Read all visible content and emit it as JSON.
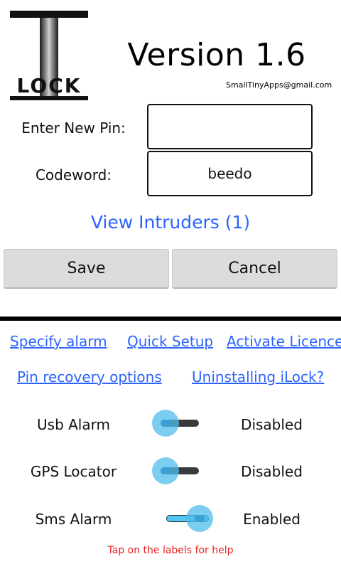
{
  "app": {
    "logo_text": "LOCK",
    "version": "Version 1.6",
    "email": "SmallTinyApps@gmail.com"
  },
  "form": {
    "pin_label": "Enter New Pin:",
    "pin_value": "",
    "codeword_label": "Codeword:",
    "codeword_value": "beedo"
  },
  "intruders_link": "View Intruders (1)",
  "buttons": {
    "save": "Save",
    "cancel": "Cancel"
  },
  "links": {
    "specify_alarm": "Specify alarm",
    "quick_setup": "Quick Setup",
    "activate_licence": "Activate Licence",
    "pin_recovery": "Pin recovery options",
    "uninstalling": "Uninstalling iLock?"
  },
  "toggles": [
    {
      "label": "Usb Alarm",
      "state": "Disabled",
      "on": false
    },
    {
      "label": "GPS Locator",
      "state": "Disabled",
      "on": false
    },
    {
      "label": "Sms Alarm",
      "state": "Enabled",
      "on": true
    }
  ],
  "hint": "Tap on the labels for help",
  "colors": {
    "link": "#2b63ff",
    "hint": "#e81f1f",
    "switch_accent": "#4fc7f2"
  }
}
